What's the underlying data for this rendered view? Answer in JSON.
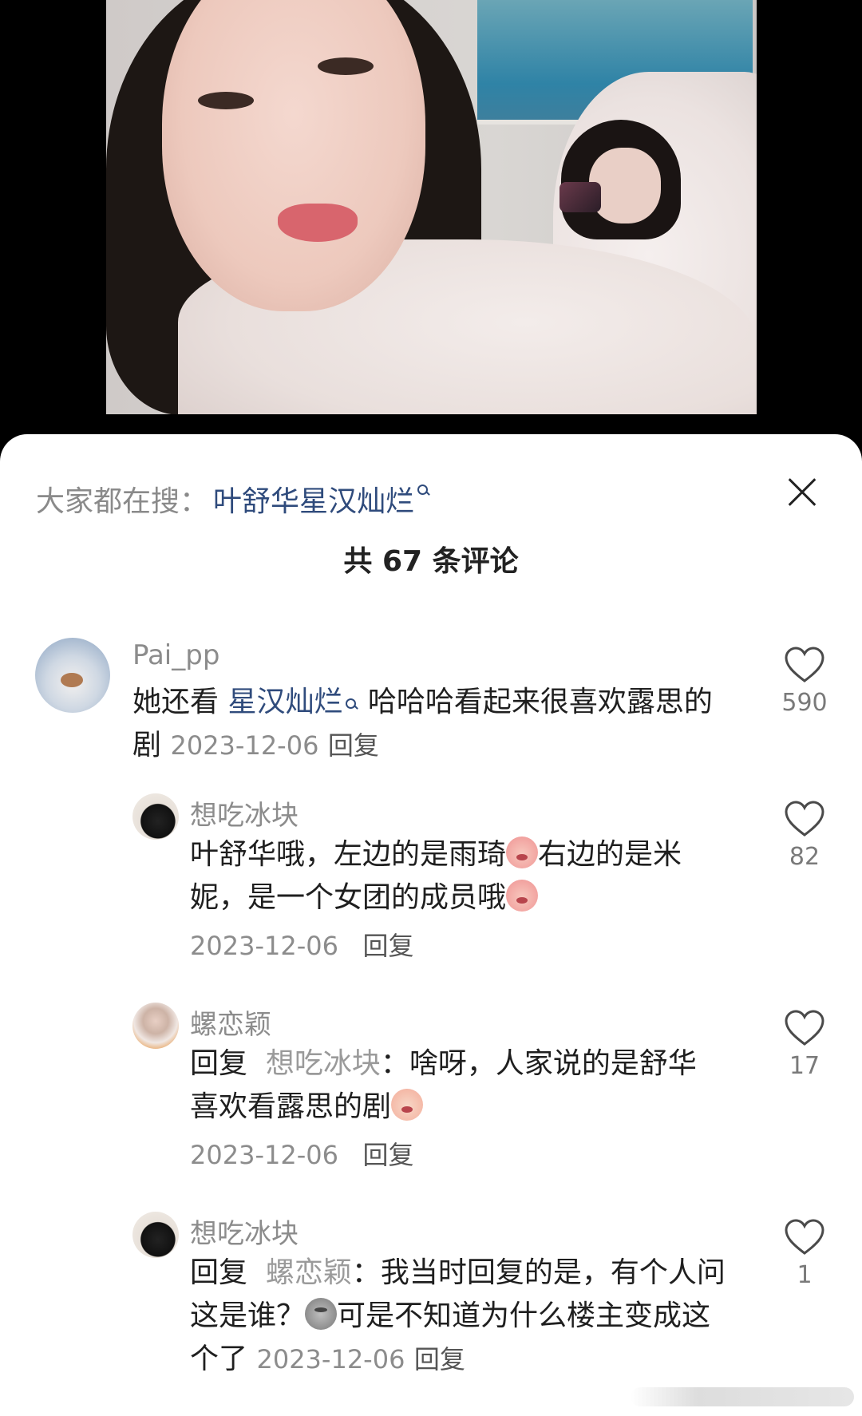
{
  "search": {
    "prefix": "大家都在搜：",
    "term": "叶舒华星汉灿烂"
  },
  "comments_header": {
    "title": "共 67 条评论"
  },
  "comments": [
    {
      "username": "Pai_pp",
      "text_before": "她还看 ",
      "highlight": "星汉灿烂",
      "text_after": " 哈哈哈看起来很喜欢露思的剧",
      "date": "2023-12-06",
      "reply_label": "回复",
      "likes": "590"
    },
    {
      "username": "想吃冰块",
      "text_part1": "叶舒华哦，左边的是雨琦",
      "text_part2": "右边的是米妮，是一个女团的成员哦",
      "date": "2023-12-06",
      "reply_label": "回复",
      "likes": "82"
    },
    {
      "username": "螺恋颖",
      "reply_prefix": "回复",
      "reply_to": "想吃冰块",
      "text": "：啥呀，人家说的是舒华喜欢看露思的剧",
      "date": "2023-12-06",
      "reply_label": "回复",
      "likes": "17"
    },
    {
      "username": "想吃冰块",
      "reply_prefix": "回复",
      "reply_to": "螺恋颖",
      "text_part1": "：我当时回复的是，有个人问这是谁？",
      "text_part2": "可是不知道为什么楼主变成这个了",
      "date": "2023-12-06",
      "reply_label": "回复",
      "likes": "1"
    }
  ],
  "icons": {
    "close": "close-icon",
    "like": "heart-outline-icon",
    "search_mini": "search-icon"
  },
  "colors": {
    "link": "#2f4b7c",
    "meta": "#8c8c8c",
    "text": "#1f1f1f"
  }
}
